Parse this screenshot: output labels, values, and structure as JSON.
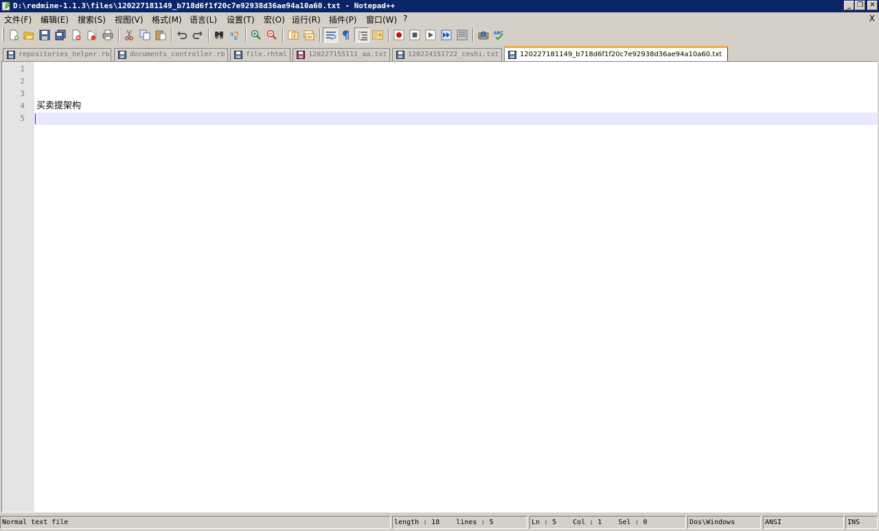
{
  "window": {
    "title": "D:\\redmine-1.1.3\\files\\120227181149_b718d6f1f20c7e92938d36ae94a10a60.txt - Notepad++",
    "minimize": "_",
    "restore": "❐",
    "close": "✕"
  },
  "menu": {
    "items": [
      "文件(F)",
      "编辑(E)",
      "搜索(S)",
      "视图(V)",
      "格式(M)",
      "语言(L)",
      "设置(T)",
      "宏(O)",
      "运行(R)",
      "插件(P)",
      "窗口(W)",
      "?"
    ],
    "close": "X"
  },
  "toolbar": {
    "buttons": [
      "new",
      "open",
      "save",
      "save-all",
      "close",
      "close-all",
      "print",
      "cut",
      "copy",
      "paste",
      "undo",
      "redo",
      "find",
      "replace",
      "zoom-in",
      "zoom-out",
      "sync-vertical",
      "sync-horizontal",
      "word-wrap",
      "show-all-chars",
      "indent-guide",
      "doc-map",
      "record-macro",
      "stop-macro",
      "play-macro",
      "run-macro-multiple",
      "save-macro",
      "launch-browser",
      "spell-check"
    ]
  },
  "tabs": [
    {
      "label": "repositories_helper.rb",
      "active": false,
      "state": "saved"
    },
    {
      "label": "documents_controller.rb",
      "active": false,
      "state": "saved"
    },
    {
      "label": "file.rhtml",
      "active": false,
      "state": "saved"
    },
    {
      "label": "120227155111_aa.txt",
      "active": false,
      "state": "modified"
    },
    {
      "label": "120224151722_ceshi.txt",
      "active": false,
      "state": "saved"
    },
    {
      "label": "120227181149_b718d6f1f20c7e92938d36ae94a10a60.txt",
      "active": true,
      "state": "saved"
    }
  ],
  "editor": {
    "lines": [
      "",
      "",
      "",
      "买卖提架构",
      ""
    ],
    "line_numbers": [
      "1",
      "2",
      "3",
      "4",
      "5"
    ],
    "current_line": 5
  },
  "status": {
    "file_type": "Normal text file",
    "length_lines": "length : 18    lines : 5",
    "position": "Ln : 5    Col : 1    Sel : 0",
    "eol": "Dos\\Windows",
    "encoding": "ANSI",
    "mode": "INS"
  },
  "colors": {
    "titlebar": "#0a246a",
    "active_tab_accent": "#faaa3c",
    "current_line": "#e8e8ff",
    "caret": "#8000ff"
  }
}
